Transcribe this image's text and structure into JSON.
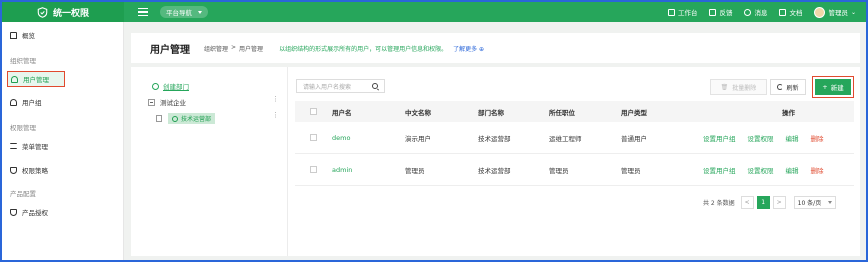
{
  "app": {
    "title": "统一权限",
    "nav_select": "平台导航"
  },
  "topbar": {
    "links": [
      {
        "icon": "home-icon",
        "label": "工作台"
      },
      {
        "icon": "feedback-icon",
        "label": "反馈"
      },
      {
        "icon": "bell-icon",
        "label": "消息"
      },
      {
        "icon": "doc-icon",
        "label": "文档"
      }
    ],
    "user": "管理员"
  },
  "sidebar": {
    "overview": "概览",
    "groups": [
      {
        "title": "组织管理",
        "items": [
          "用户管理",
          "用户组"
        ]
      },
      {
        "title": "权限管理",
        "items": [
          "菜单管理",
          "权限策略"
        ]
      },
      {
        "title": "产品配置",
        "items": [
          "产品授权"
        ]
      }
    ]
  },
  "header": {
    "title": "用户管理",
    "breadcrumb": [
      "组织管理",
      ">",
      "用户管理"
    ],
    "description": "以组织结构的形式展示所有的用户，可以管理用户信息和权限。",
    "more": "了解更多 ⊕"
  },
  "tree": {
    "create": "创建部门",
    "root": "测试企业",
    "child": "技术运营部"
  },
  "toolbar": {
    "search_placeholder": "请输入用户名搜索",
    "batch_delete": "批量删除",
    "refresh": "刷新",
    "new": "新建"
  },
  "table": {
    "headers": [
      "用户名",
      "中文名称",
      "部门名称",
      "所任职位",
      "用户类型",
      "操作"
    ],
    "rows": [
      {
        "username": "demo",
        "name": "演示用户",
        "dept": "技术运营部",
        "position": "运维工程师",
        "type": "普通用户"
      },
      {
        "username": "admin",
        "name": "管理员",
        "dept": "技术运营部",
        "position": "管理员",
        "type": "管理员"
      }
    ],
    "ops": [
      "设置用户组",
      "设置权限",
      "编辑",
      "删除"
    ]
  },
  "pagination": {
    "total": "共 2 条数据",
    "page": "1",
    "prev": "<",
    "next": ">",
    "size": "10 条/页"
  },
  "colors": {
    "primary": "#26a65b",
    "danger": "#e04a2f",
    "highlight": "#2a66d9"
  }
}
